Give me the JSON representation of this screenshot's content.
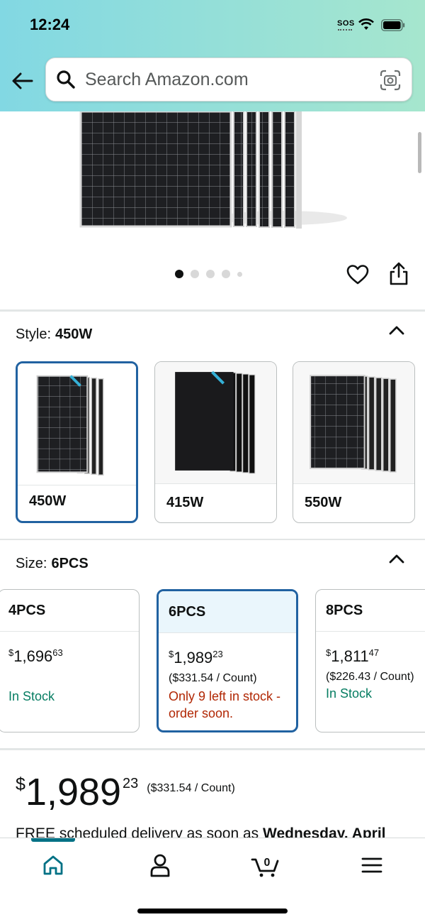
{
  "status_bar": {
    "time": "12:24",
    "sos": "SOS"
  },
  "search": {
    "placeholder": "Search Amazon.com"
  },
  "gallery": {
    "dots": 5,
    "active_index": 0
  },
  "style": {
    "label": "Style:",
    "selected": "450W",
    "options": [
      {
        "name": "450W"
      },
      {
        "name": "415W"
      },
      {
        "name": "550W"
      }
    ]
  },
  "size": {
    "label": "Size:",
    "selected": "6PCS",
    "options": [
      {
        "name": "4PCS",
        "price_currency": "$",
        "price_whole": "1,696",
        "price_fraction": "63",
        "unit_price": "",
        "stock": "In Stock",
        "stock_status": "in_stock"
      },
      {
        "name": "6PCS",
        "price_currency": "$",
        "price_whole": "1,989",
        "price_fraction": "23",
        "unit_price": "($331.54 / Count)",
        "stock": "Only 9 left in stock - order soon.",
        "stock_status": "low"
      },
      {
        "name": "8PCS",
        "price_currency": "$",
        "price_whole": "1,811",
        "price_fraction": "47",
        "unit_price": "($226.43 / Count)",
        "stock": "In Stock",
        "stock_status": "in_stock"
      }
    ]
  },
  "buybox": {
    "currency": "$",
    "whole": "1,989",
    "fraction": "23",
    "unit_price": "($331.54 / Count)",
    "delivery_prefix": "FREE scheduled delivery as soon as ",
    "delivery_date": "Wednesday, April"
  },
  "bottom_nav": {
    "items": [
      "home-icon",
      "account-icon",
      "cart-icon",
      "menu-icon"
    ],
    "cart_count": "0"
  },
  "colors": {
    "selected_border": "#2162a1",
    "in_stock": "#067d62",
    "low_stock": "#b12704",
    "nav_active": "#007185"
  }
}
